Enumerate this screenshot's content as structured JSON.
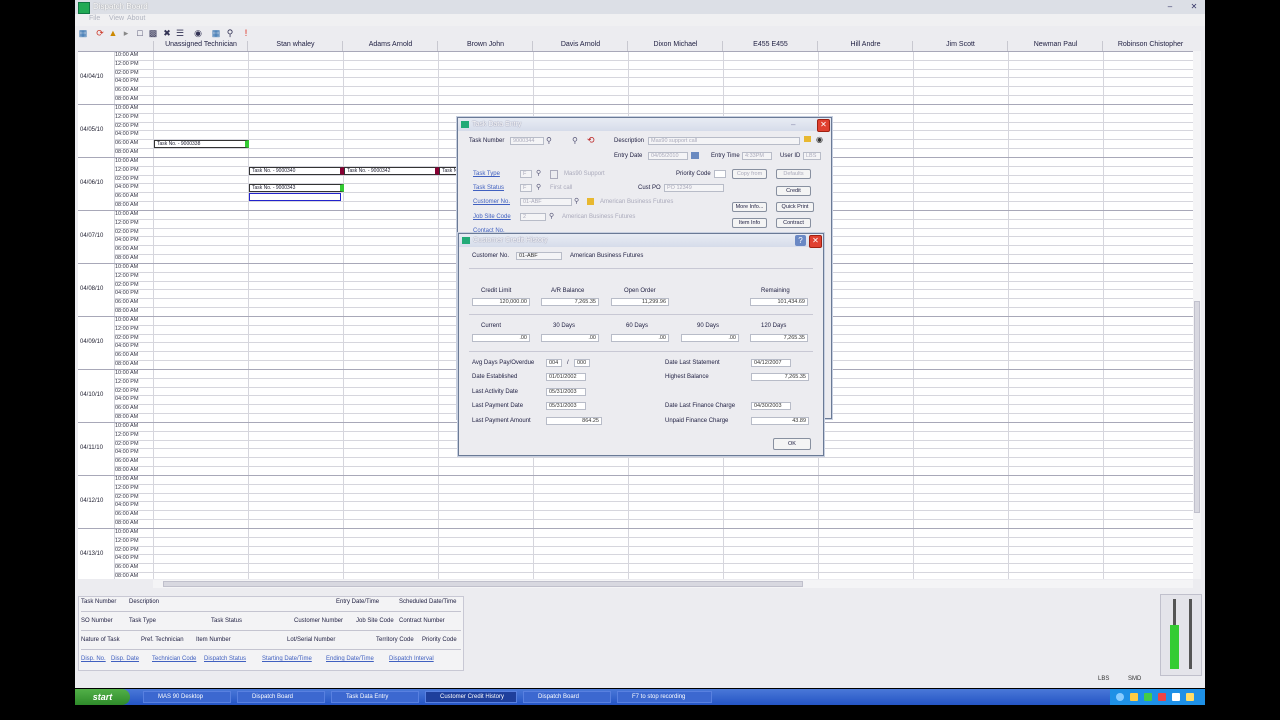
{
  "window": {
    "title": "Dispatch Board",
    "menu": [
      "File",
      "View",
      "About"
    ]
  },
  "technicians": [
    "Unassigned Technician",
    "Stan whaley",
    "Adams Arnold",
    "Brown John",
    "Davis Arnold",
    "Dixon Michael",
    "E455 E455",
    "Hill Andre",
    "Jim Scott",
    "Newman Paul",
    "Robinson Chistopher"
  ],
  "dates": [
    "04/04/10",
    "04/05/10",
    "04/06/10",
    "04/07/10",
    "04/08/10",
    "04/09/10",
    "04/10/10",
    "04/11/10",
    "04/12/10",
    "04/13/10",
    "04/14/10"
  ],
  "times": [
    "10:00 AM",
    "12:00 PM",
    "02:00 PM",
    "04:00 PM",
    "06:00 AM",
    "08:00 AM"
  ],
  "tasks": [
    {
      "label": "Task No. - 9000338"
    },
    {
      "label": "Task No. - 9000340"
    },
    {
      "label": "Task No. - 9000342"
    },
    {
      "label": "Task No. - 9000343"
    },
    {
      "label": "Task N"
    }
  ],
  "filter": {
    "row1": [
      "Task Number",
      "Description",
      "Entry Date/Time",
      "Scheduled Date/Time"
    ],
    "row2": [
      "SO Number",
      "Task Type",
      "Task Status",
      "Customer Number",
      "Job Site Code",
      "Contract Number"
    ],
    "row3": [
      "Nature of Task",
      "Pref. Technician",
      "Item Number",
      "Lot/Serial Number",
      "Territory Code",
      "Priority Code"
    ],
    "row4": [
      "Disp. No.",
      "Disp. Date",
      "Technician Code",
      "Dispatch Status",
      "Starting Date/Time",
      "Ending Date/Time",
      "Dispatch Interval"
    ]
  },
  "status": {
    "user": "LBS",
    "company": "SMD"
  },
  "taskbar": {
    "start": "start",
    "items": [
      "MAS 90 Desktop",
      "Dispatch Board",
      "Task Data Entry",
      "Customer Credit History",
      "Dispatch Board",
      "F7 to stop recording"
    ]
  },
  "taskEntry": {
    "title": "Task Data Entry",
    "taskNumberLabel": "Task Number",
    "taskNumber": "9000344",
    "descriptionLabel": "Description",
    "description": "Mas90 support call",
    "entryDateLabel": "Entry Date",
    "entryDate": "04/05/2010",
    "entryTimeLabel": "Entry Time",
    "entryTime": "4:33PM",
    "userIdLabel": "User ID",
    "userId": "LBS",
    "taskTypeLabel": "Task Type",
    "taskType": "F",
    "taskTypeDesc": "Mas90 Support",
    "taskStatusLabel": "Task Status",
    "taskStatus": "F",
    "taskStatusDesc": "First call",
    "customerNoLabel": "Customer No.",
    "customerNo": "01-ABF",
    "customerName": "American Business Futures",
    "jobSiteLabel": "Job Site Code",
    "jobSite": "2",
    "jobSiteName": "American Business Futures",
    "contactLabel": "Contact No.",
    "priorityLabel": "Priority Code",
    "custPoLabel": "Cust PO",
    "custPo": "PO 12349",
    "buttons": [
      "Copy from",
      "Defaults",
      "More Info...",
      "Quick Print",
      "Item Info",
      "Contract",
      "Credit"
    ]
  },
  "credit": {
    "title": "Customer Credit History",
    "customerNoLabel": "Customer No.",
    "customerNo": "01-ABF",
    "customerName": "American Business Futures",
    "creditLimitLabel": "Credit Limit",
    "creditLimit": "120,000.00",
    "arBalanceLabel": "A/R Balance",
    "arBalance": "7,265.35",
    "openOrderLabel": "Open Order",
    "openOrder": "11,299.96",
    "remainingLabel": "Remaining",
    "remaining": "101,434.69",
    "agingLabels": [
      "Current",
      "30 Days",
      "60 Days",
      "90 Days",
      "120 Days"
    ],
    "agingValues": [
      ".00",
      ".00",
      ".00",
      ".00",
      "7,265.35"
    ],
    "avgDaysLabel": "Avg Days Pay/Overdue",
    "avgDaysPay": "004",
    "avgDaysSlash": "/",
    "avgDaysOverdue": "000",
    "dateEstablishedLabel": "Date Established",
    "dateEstablished": "01/01/2002",
    "lastActivityLabel": "Last Activity Date",
    "lastActivity": "05/31/2003",
    "lastPaymentDateLabel": "Last Payment Date",
    "lastPaymentDate": "05/31/2003",
    "lastPaymentAmountLabel": "Last Payment Amount",
    "lastPaymentAmount": "864.25",
    "dateLastStatementLabel": "Date Last Statement",
    "dateLastStatement": "04/12/2007",
    "highestBalanceLabel": "Highest Balance",
    "highestBalance": "7,265.35",
    "dateLastFinanceLabel": "Date Last Finance Charge",
    "dateLastFinance": "04/30/2003",
    "unpaidFinanceLabel": "Unpaid Finance Charge",
    "unpaidFinance": "43.89",
    "okLabel": "OK"
  }
}
